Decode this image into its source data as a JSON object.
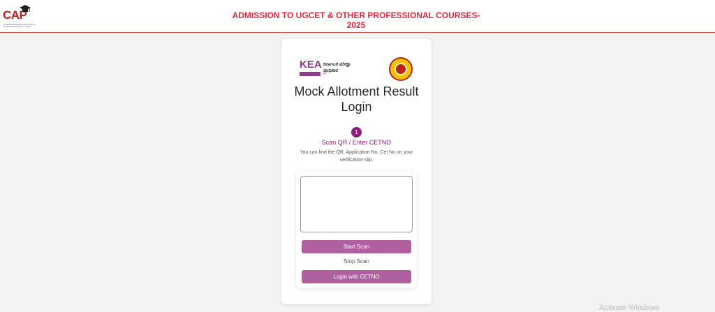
{
  "header": {
    "logo_text": "CAP",
    "logo_subtext": "Centralised Admission Process for Professional Degree Courses",
    "title": "ADMISSION TO UGCET & OTHER PROFESSIONAL COURSES-2025"
  },
  "card": {
    "kea_letters": "KEA",
    "kea_kannada": "ಕರ್ನಾಟಕ ಪರೀಕ್ಷಾ ಪ್ರಾಧಿಕಾರ",
    "title": "Mock Allotment Result Login",
    "step_number": "1",
    "step_label": "Scan QR / Enter CETNO",
    "hint": "You can find the QR, Application No, Cet No on your verification slip.",
    "start_scan": "Start Scan",
    "stop_scan": "Stop Scan",
    "login_cetno": "Login with CETNO"
  },
  "watermark": "Activate Windows",
  "colors": {
    "title_red": "#e0263a",
    "step_purple": "#8b1e7a",
    "button_mauve": "#b0609f"
  }
}
